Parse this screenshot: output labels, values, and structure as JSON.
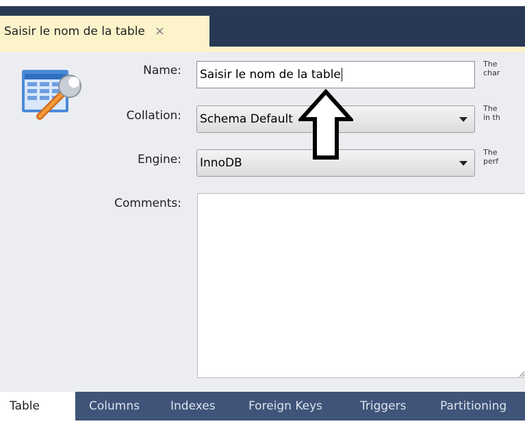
{
  "editor_tab": {
    "title": "Saisir le nom de la table",
    "close_glyph": "×"
  },
  "form": {
    "name": {
      "label": "Name:",
      "value": "Saisir le nom de la table",
      "hint": "The\nchar"
    },
    "collation": {
      "label": "Collation:",
      "value": "Schema Default",
      "hint": "The\nin th"
    },
    "engine": {
      "label": "Engine:",
      "value": "InnoDB",
      "hint": "The\nperf"
    },
    "comments": {
      "label": "Comments:",
      "value": ""
    }
  },
  "bottom_tabs": [
    {
      "label": "Table",
      "active": true
    },
    {
      "label": "Columns",
      "active": false
    },
    {
      "label": "Indexes",
      "active": false
    },
    {
      "label": "Foreign Keys",
      "active": false
    },
    {
      "label": "Triggers",
      "active": false
    },
    {
      "label": "Partitioning",
      "active": false
    }
  ],
  "icons": [
    "table-settings-icon",
    "close-icon",
    "chevron-down-icon",
    "annotation-arrow-icon"
  ],
  "colors": {
    "chrome": "#293955",
    "active_tab": "#fdf3cb",
    "panel": "#ebedf1",
    "tab_strip": "#3f5478"
  }
}
